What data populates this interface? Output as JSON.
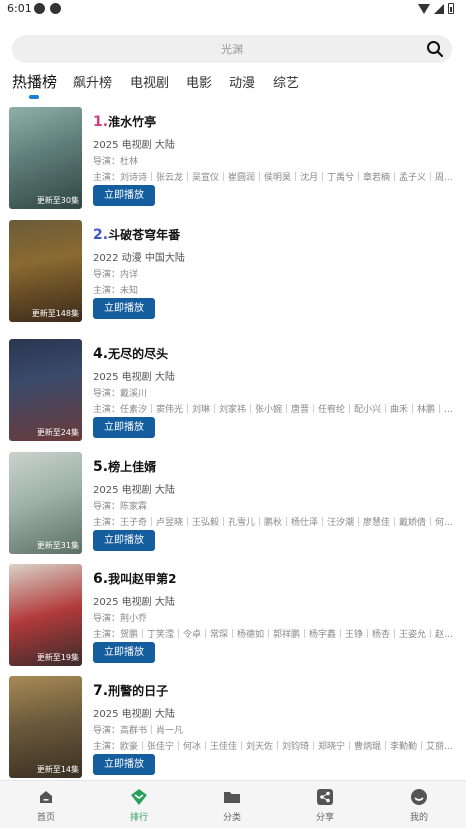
{
  "status_bar": {
    "time": "6:01"
  },
  "search": {
    "placeholder": "光渊"
  },
  "tabs": [
    {
      "label": "热播榜",
      "active": true
    },
    {
      "label": "飙升榜"
    },
    {
      "label": "电视剧"
    },
    {
      "label": "电影"
    },
    {
      "label": "动漫"
    },
    {
      "label": "综艺"
    }
  ],
  "colors": {
    "accent": "#1a7fd6",
    "play_button": "#155e9e",
    "nav_active": "#2b9f5c",
    "rank_1": "#d63b7a",
    "rank_2": "#3a56c9"
  },
  "list": [
    {
      "rank": "1.",
      "title": "淮水竹亭",
      "year": "2025",
      "type": "电视剧",
      "region": "大陆",
      "director": "导演：杜林",
      "cast": "主演：刘诗诗｜张云龙｜吴宣仪｜崔圆润｜侯明昊｜沈月｜丁禹兮｜章若楠｜孟子义｜周...",
      "episodes": "更新至30集",
      "play": "立即播放"
    },
    {
      "rank": "2.",
      "title": "斗破苍穹年番",
      "year": "2022",
      "type": "动漫",
      "region": "中国大陆",
      "director": "导演：内详",
      "cast": "主演：未知",
      "episodes": "更新至148集",
      "play": "立即播放"
    },
    {
      "rank": "4.",
      "title": "无尽的尽头",
      "year": "2025",
      "type": "电视剧",
      "region": "大陆",
      "director": "导演：戴溪川",
      "cast": "主演：任素汐｜窦伟光｜刘琳｜刘家祎｜张小婉｜唐晋｜任宥纶｜配小兴｜曲禾｜林鹏｜曹...",
      "episodes": "更新至24集",
      "play": "立即播放"
    },
    {
      "rank": "5.",
      "title": "榜上佳婿",
      "year": "2025",
      "type": "电视剧",
      "region": "大陆",
      "director": "导演：陈家霖",
      "cast": "主演：王子奇｜卢昱晓｜王弘毅｜孔雪儿｜鹏秋｜杨仕泽｜汪汐潮｜廖慧佳｜戴娇倩｜何...",
      "episodes": "更新至31集",
      "play": "立即播放"
    },
    {
      "rank": "6.",
      "title": "我叫赵甲第2",
      "year": "2025",
      "type": "电视剧",
      "region": "大陆",
      "director": "导演：荆小乔",
      "cast": "主演：贺鹏｜丁笑滢｜令卓｜常琛｜杨德如｜郭祥鹏｜杨宇鑫｜王铮｜杨杏｜王姿允｜赵龙...",
      "episodes": "更新至19集",
      "play": "立即播放"
    },
    {
      "rank": "7.",
      "title": "刑警的日子",
      "year": "2025",
      "type": "电视剧",
      "region": "大陆",
      "director": "导演：高群书｜肖一凡",
      "cast": "主演：欧豪｜张佳宁｜何冰｜王佳佳｜刘天佐｜刘钧琦｜郑晓宁｜曹炳琨｜李勤勤｜艾丽...",
      "episodes": "更新至14集",
      "play": "立即播放"
    }
  ],
  "bottom_nav": [
    {
      "label": "首页",
      "icon": "home-icon"
    },
    {
      "label": "排行",
      "icon": "ranking-icon",
      "active": true
    },
    {
      "label": "分类",
      "icon": "folder-icon"
    },
    {
      "label": "分享",
      "icon": "share-icon"
    },
    {
      "label": "我的",
      "icon": "profile-icon"
    }
  ]
}
